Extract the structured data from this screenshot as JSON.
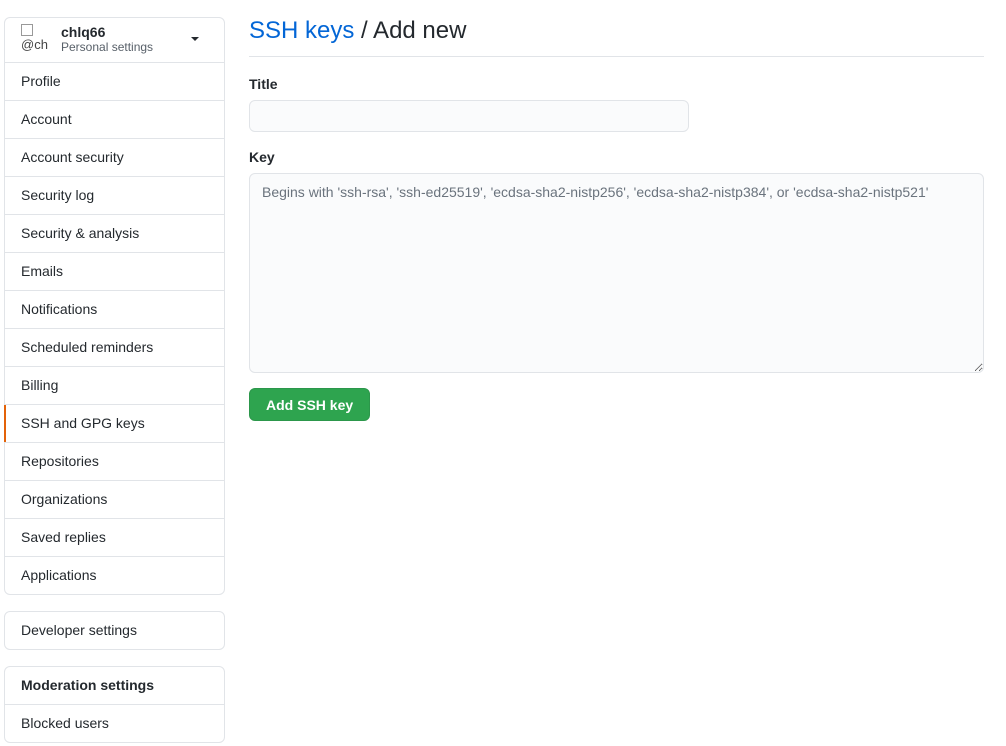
{
  "sidebar": {
    "user": {
      "avatar_alt": "@ch",
      "username": "chlq66",
      "subtitle": "Personal settings"
    },
    "items": [
      {
        "label": "Profile"
      },
      {
        "label": "Account"
      },
      {
        "label": "Account security"
      },
      {
        "label": "Security log"
      },
      {
        "label": "Security & analysis"
      },
      {
        "label": "Emails"
      },
      {
        "label": "Notifications"
      },
      {
        "label": "Scheduled reminders"
      },
      {
        "label": "Billing"
      },
      {
        "label": "SSH and GPG keys",
        "selected": true
      },
      {
        "label": "Repositories"
      },
      {
        "label": "Organizations"
      },
      {
        "label": "Saved replies"
      },
      {
        "label": "Applications"
      }
    ],
    "developer_settings": "Developer settings",
    "moderation": {
      "heading": "Moderation settings",
      "blocked_users": "Blocked users"
    }
  },
  "main": {
    "breadcrumb_link": "SSH keys",
    "breadcrumb_rest": " / Add new",
    "title_label": "Title",
    "title_value": "",
    "key_label": "Key",
    "key_placeholder": "Begins with 'ssh-rsa', 'ssh-ed25519', 'ecdsa-sha2-nistp256', 'ecdsa-sha2-nistp384', or 'ecdsa-sha2-nistp521'",
    "submit_label": "Add SSH key"
  },
  "colors": {
    "link": "#0366d6",
    "primary_button": "#2ea44f",
    "selected_indicator": "#e36209"
  }
}
